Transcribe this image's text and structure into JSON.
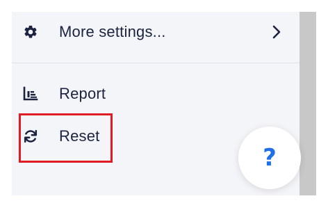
{
  "menu": {
    "items": [
      {
        "label": "More settings...",
        "icon": "gear-icon",
        "has_submenu": true
      },
      {
        "label": "Report",
        "icon": "bar-chart-icon",
        "has_submenu": false
      },
      {
        "label": "Reset",
        "icon": "refresh-icon",
        "has_submenu": false
      }
    ]
  },
  "help": {
    "label": "?",
    "icon": "help-icon"
  },
  "colors": {
    "panel_background": "#f4f5f9",
    "text": "#1c2340",
    "help_accent": "#1f6fe8",
    "highlight": "#e01b24"
  }
}
